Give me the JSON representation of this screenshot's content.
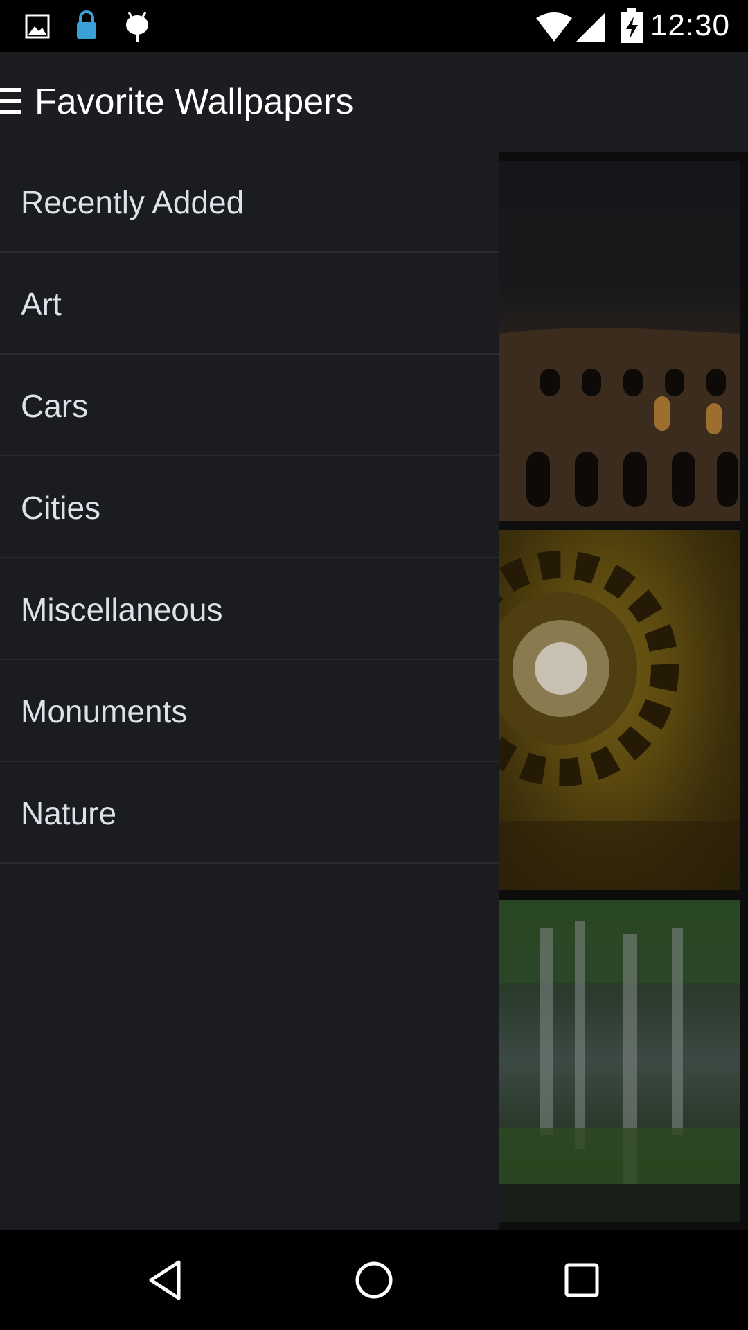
{
  "status_bar": {
    "time": "12:30",
    "icons": [
      "image-icon",
      "lock-icon",
      "android-icon",
      "wifi-icon",
      "signal-icon",
      "battery-charging-icon"
    ]
  },
  "app_bar": {
    "title": "Favorite Wallpapers",
    "menu_icon": "hamburger-menu-icon"
  },
  "drawer": {
    "items": [
      {
        "label": "Recently Added"
      },
      {
        "label": "Art"
      },
      {
        "label": "Cars"
      },
      {
        "label": "Cities"
      },
      {
        "label": "Miscellaneous"
      },
      {
        "label": "Monuments"
      },
      {
        "label": "Nature"
      }
    ]
  },
  "nav_bar": {
    "icons": [
      "back-icon",
      "home-icon",
      "recents-icon"
    ]
  }
}
